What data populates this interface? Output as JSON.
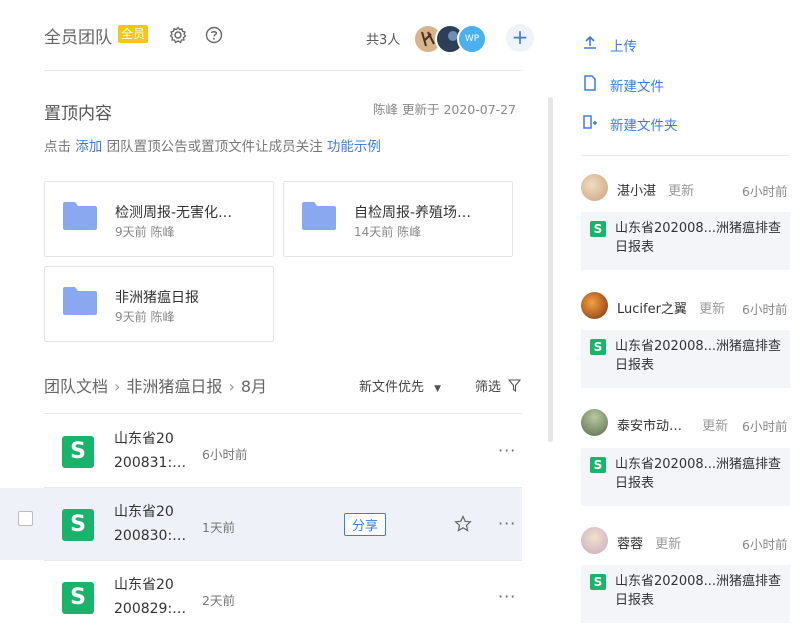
{
  "header": {
    "team_title": "全员团队",
    "badge": "全员",
    "member_count": "共3人",
    "avatar3_text": "WP",
    "add_label": "+"
  },
  "pinned": {
    "title": "置顶内容",
    "meta": "陈峰 更新于 2020-07-27",
    "hint_prefix": "点击",
    "hint_link": "添加",
    "hint_text": "团队置顶公告或置顶文件让成员关注",
    "hint_example": "功能示例",
    "cards": [
      {
        "name": "检测周报-无害化…",
        "sub": "9天前 陈峰"
      },
      {
        "name": "自检周报-养殖场…",
        "sub": "14天前 陈峰"
      },
      {
        "name": "非洲猪瘟日报",
        "sub": "9天前 陈峰"
      }
    ]
  },
  "docs": {
    "breadcrumb": [
      "团队文档",
      "非洲猪瘟日报",
      "8月"
    ],
    "sort_label": "新文件优先",
    "filter_label": "筛选",
    "share_label": "分享",
    "more_label": "···",
    "files": [
      {
        "line1": "山东省20",
        "line2": "200831:…",
        "time": "6小时前"
      },
      {
        "line1": "山东省20",
        "line2": "200830:…",
        "time": "1天前"
      },
      {
        "line1": "山东省20",
        "line2": "200829:…",
        "time": "2天前"
      }
    ]
  },
  "actions": {
    "upload": "上传",
    "new_file": "新建文件",
    "new_folder": "新建文件夹"
  },
  "feed": [
    {
      "user": "湛小湛",
      "verb": "更新",
      "time": "6小时前",
      "file": "山东省202008...洲猪瘟排查日报表"
    },
    {
      "user": "Lucifer之翼",
      "verb": "更新",
      "time": "6小时前",
      "file": "山东省202008...洲猪瘟排查日报表"
    },
    {
      "user": "泰安市动…",
      "verb": "更新",
      "time": "6小时前",
      "file": "山东省202008...洲猪瘟排查日报表"
    },
    {
      "user": "蓉蓉",
      "verb": "更新",
      "time": "6小时前",
      "file": "山东省202008...洲猪瘟排查日报表"
    }
  ],
  "colors": {
    "accent": "#3d7be0",
    "badge": "#f5c518",
    "file_icon": "#19b36b",
    "folder": "#8aa8f0",
    "selected_row": "#eef1f7"
  }
}
